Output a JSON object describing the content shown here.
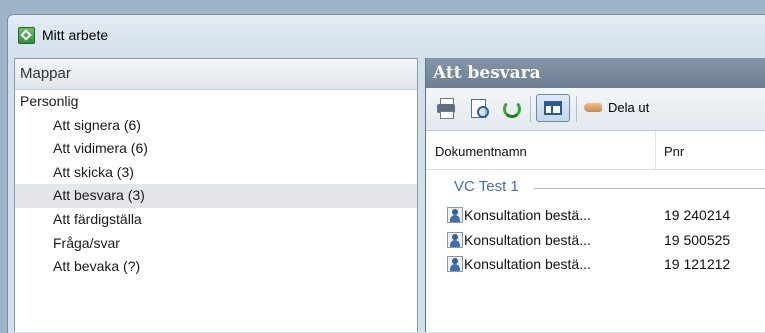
{
  "window": {
    "title": "Mitt arbete"
  },
  "folders": {
    "header": "Mappar",
    "items": [
      {
        "label": "Personlig",
        "level": 0,
        "selected": false
      },
      {
        "label": "Att signera (6)",
        "level": 1,
        "selected": false
      },
      {
        "label": "Att vidimera (6)",
        "level": 1,
        "selected": false
      },
      {
        "label": "Att skicka (3)",
        "level": 1,
        "selected": false
      },
      {
        "label": "Att besvara (3)",
        "level": 1,
        "selected": true
      },
      {
        "label": "Att färdigställa",
        "level": 1,
        "selected": false
      },
      {
        "label": "Fråga/svar",
        "level": 1,
        "selected": false
      },
      {
        "label": "Att bevaka (?)",
        "level": 1,
        "selected": false
      }
    ]
  },
  "content": {
    "header": "Att besvara",
    "toolbar": {
      "print_icon": "printer-icon",
      "preview_icon": "print-preview-icon",
      "refresh_icon": "refresh-icon",
      "layout_icon": "preview-pane-icon",
      "dela_ut_label": "Dela ut"
    },
    "columns": {
      "document": "Dokumentnamn",
      "pnr": "Pnr"
    },
    "group": "VC Test 1",
    "rows": [
      {
        "name": "Konsultation bestä...",
        "pnr": "19  240214"
      },
      {
        "name": "Konsultation bestä...",
        "pnr": "19  500525"
      },
      {
        "name": "Konsultation bestä...",
        "pnr": "19  121212"
      }
    ]
  },
  "colors": {
    "header_bar": "#7a8c9f",
    "selected_row": "#e4e6e9",
    "group_text": "#3f6fb5"
  }
}
